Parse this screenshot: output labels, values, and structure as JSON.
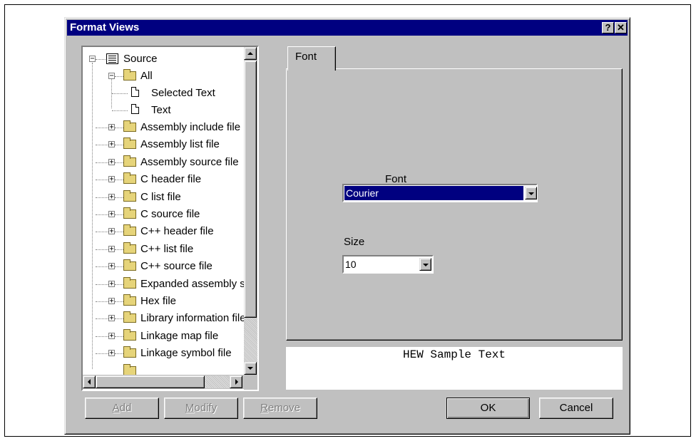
{
  "dialog": {
    "title": "Format Views",
    "help_label": "?",
    "close_label": "✕"
  },
  "tree": {
    "root": "Source",
    "all": "All",
    "all_children": [
      "Selected Text",
      "Text"
    ],
    "items": [
      "Assembly include file",
      "Assembly list file",
      "Assembly source file",
      "C header file",
      "C list file",
      "C source file",
      "C++ header file",
      "C++ list file",
      "C++ source file",
      "Expanded assembly s",
      "Hex file",
      "Library information file",
      "Linkage map file",
      "Linkage symbol file"
    ]
  },
  "tab": {
    "label": "Font"
  },
  "font": {
    "label": "Font",
    "value": "Courier"
  },
  "size": {
    "label": "Size",
    "value": "10"
  },
  "preview": {
    "text": "HEW Sample Text"
  },
  "buttons": {
    "add": {
      "accel": "A",
      "rest": "dd"
    },
    "modify": {
      "accel": "M",
      "rest": "odify"
    },
    "remove": {
      "accel": "R",
      "rest": "emove"
    },
    "ok": "OK",
    "cancel": "Cancel"
  },
  "icons": {
    "expand": "plus-box-icon",
    "collapse": "minus-box-icon",
    "folder": "folder-icon",
    "document": "document-icon",
    "source": "source-icon"
  }
}
